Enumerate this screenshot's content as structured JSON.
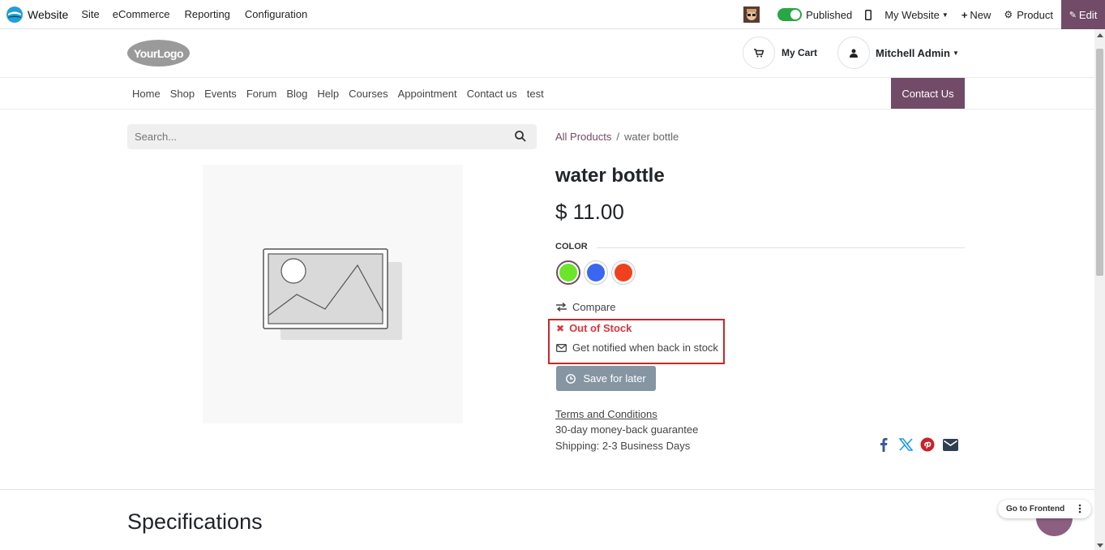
{
  "topbar": {
    "app_name": "Website",
    "menus": [
      "Site",
      "eCommerce",
      "Reporting",
      "Configuration"
    ],
    "published_label": "Published",
    "website_label": "My Website",
    "new_label": "New",
    "product_label": "Product",
    "edit_label": "Edit"
  },
  "header": {
    "logo_text": "YourLogo",
    "cart_label": "My Cart",
    "user_name": "Mitchell Admin"
  },
  "nav": {
    "items": [
      "Home",
      "Shop",
      "Events",
      "Forum",
      "Blog",
      "Help",
      "Courses",
      "Appointment",
      "Contact us",
      "test"
    ],
    "contact_button": "Contact Us"
  },
  "search": {
    "placeholder": "Search..."
  },
  "breadcrumb": {
    "parent": "All Products",
    "separator": "/",
    "current": "water bottle"
  },
  "product": {
    "name": "water bottle",
    "price": "$ 11.00",
    "attribute_label": "COLOR",
    "colors": [
      {
        "hex": "#6ae52a",
        "selected": true
      },
      {
        "hex": "#3a66f0",
        "selected": false
      },
      {
        "hex": "#f0401e",
        "selected": false
      }
    ],
    "compare_label": "Compare",
    "stock_status": "Out of Stock",
    "notify_label": "Get notified when back in stock",
    "save_label": "Save for later",
    "terms_label": "Terms and Conditions",
    "guarantee": "30-day money-back guarantee",
    "shipping": "Shipping: 2-3 Business Days"
  },
  "share_icons": [
    "facebook-icon",
    "x-twitter-icon",
    "pinterest-icon",
    "email-icon"
  ],
  "specifications_title": "Specifications",
  "frontend_button": "Go to Frontend",
  "colors": {
    "brand": "#714b67",
    "danger": "#d9363e",
    "secondary": "#8595a2",
    "highlight": "#c62828"
  }
}
